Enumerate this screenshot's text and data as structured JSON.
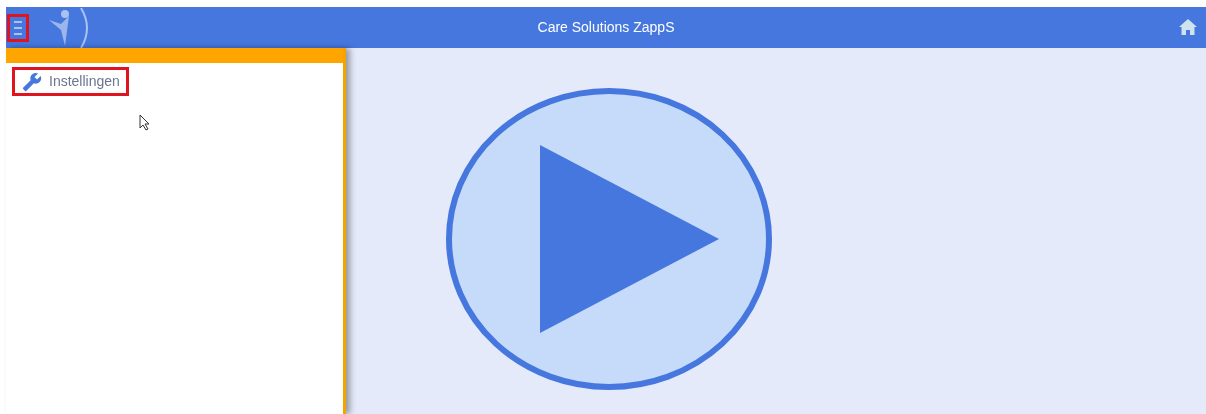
{
  "header": {
    "title": "Care Solutions ZappS",
    "menu_highlighted": true
  },
  "sidebar": {
    "items": [
      {
        "label": "Instellingen",
        "highlighted": true
      }
    ]
  }
}
